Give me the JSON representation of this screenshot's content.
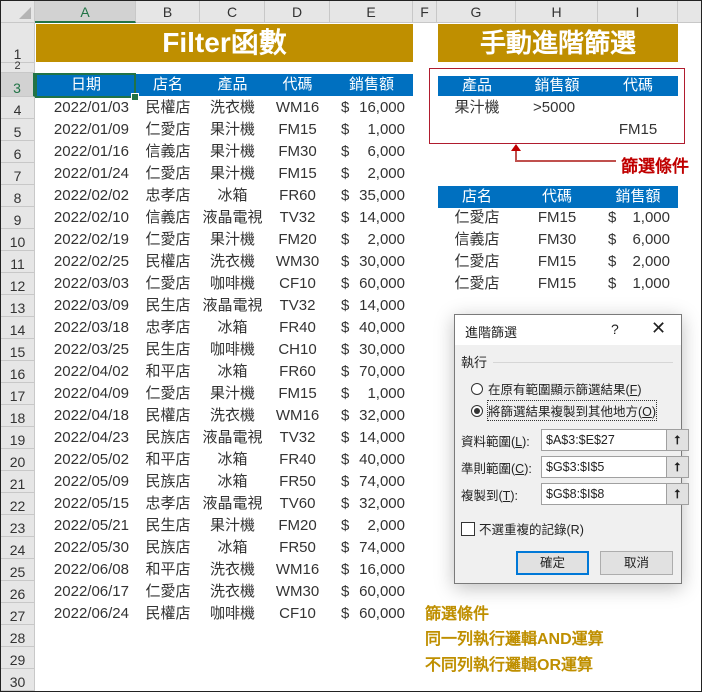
{
  "columns": [
    "A",
    "B",
    "C",
    "D",
    "E",
    "F",
    "G",
    "H",
    "I"
  ],
  "rows": [
    "1",
    "2",
    "3",
    "4",
    "5",
    "6",
    "7",
    "8",
    "9",
    "10",
    "11",
    "12",
    "13",
    "14",
    "15",
    "16",
    "17",
    "18",
    "19",
    "20",
    "21",
    "22",
    "23",
    "24",
    "25",
    "26",
    "27",
    "28",
    "29",
    "30"
  ],
  "left_title": "Filter函數",
  "right_title": "手動進階篩選",
  "main_table": {
    "headers": [
      "日期",
      "店名",
      "產品",
      "代碼",
      "銷售額"
    ],
    "currency_symbol": "$",
    "rows": [
      [
        "2022/01/03",
        "民權店",
        "洗衣機",
        "WM16",
        "16,000"
      ],
      [
        "2022/01/09",
        "仁愛店",
        "果汁機",
        "FM15",
        "1,000"
      ],
      [
        "2022/01/16",
        "信義店",
        "果汁機",
        "FM30",
        "6,000"
      ],
      [
        "2022/01/24",
        "仁愛店",
        "果汁機",
        "FM15",
        "2,000"
      ],
      [
        "2022/02/02",
        "忠孝店",
        "冰箱",
        "FR60",
        "35,000"
      ],
      [
        "2022/02/10",
        "信義店",
        "液晶電視",
        "TV32",
        "14,000"
      ],
      [
        "2022/02/19",
        "仁愛店",
        "果汁機",
        "FM20",
        "2,000"
      ],
      [
        "2022/02/25",
        "民權店",
        "洗衣機",
        "WM30",
        "30,000"
      ],
      [
        "2022/03/03",
        "仁愛店",
        "咖啡機",
        "CF10",
        "60,000"
      ],
      [
        "2022/03/09",
        "民生店",
        "液晶電視",
        "TV32",
        "14,000"
      ],
      [
        "2022/03/18",
        "忠孝店",
        "冰箱",
        "FR40",
        "40,000"
      ],
      [
        "2022/03/25",
        "民生店",
        "咖啡機",
        "CH10",
        "30,000"
      ],
      [
        "2022/04/02",
        "和平店",
        "冰箱",
        "FR60",
        "70,000"
      ],
      [
        "2022/04/09",
        "仁愛店",
        "果汁機",
        "FM15",
        "1,000"
      ],
      [
        "2022/04/18",
        "民權店",
        "洗衣機",
        "WM16",
        "32,000"
      ],
      [
        "2022/04/23",
        "民族店",
        "液晶電視",
        "TV32",
        "14,000"
      ],
      [
        "2022/05/02",
        "和平店",
        "冰箱",
        "FR40",
        "40,000"
      ],
      [
        "2022/05/09",
        "民族店",
        "冰箱",
        "FR50",
        "74,000"
      ],
      [
        "2022/05/15",
        "忠孝店",
        "液晶電視",
        "TV60",
        "32,000"
      ],
      [
        "2022/05/21",
        "民生店",
        "果汁機",
        "FM20",
        "2,000"
      ],
      [
        "2022/05/30",
        "民族店",
        "冰箱",
        "FR50",
        "74,000"
      ],
      [
        "2022/06/08",
        "和平店",
        "洗衣機",
        "WM16",
        "16,000"
      ],
      [
        "2022/06/17",
        "仁愛店",
        "洗衣機",
        "WM30",
        "60,000"
      ],
      [
        "2022/06/24",
        "民權店",
        "咖啡機",
        "CF10",
        "60,000"
      ]
    ]
  },
  "criteria": {
    "headers": [
      "產品",
      "銷售額",
      "代碼"
    ],
    "rows": [
      [
        "果汁機",
        ">5000",
        ""
      ],
      [
        "",
        "",
        "FM15"
      ]
    ],
    "label": "篩選條件"
  },
  "result_table": {
    "headers": [
      "店名",
      "代碼",
      "銷售額"
    ],
    "currency_symbol": "$",
    "rows": [
      [
        "仁愛店",
        "FM15",
        "1,000"
      ],
      [
        "信義店",
        "FM30",
        "6,000"
      ],
      [
        "仁愛店",
        "FM15",
        "2,000"
      ],
      [
        "仁愛店",
        "FM15",
        "1,000"
      ]
    ]
  },
  "dialog": {
    "title": "進階篩選",
    "help": "?",
    "close": "✕",
    "group_label": "執行",
    "option1": {
      "text": "在原有範圍顯示篩選結果(",
      "key": "F",
      "end": ")",
      "selected": false
    },
    "option2": {
      "text": "將篩選結果複製到其他地方(",
      "key": "O",
      "end": ")",
      "selected": true
    },
    "list_range": {
      "label": "資料範圍(",
      "key": "L",
      "end": "):",
      "value": "$A$3:$E$27"
    },
    "criteria_range": {
      "label": "準則範圍(",
      "key": "C",
      "end": "):",
      "value": "$G$3:$I$5"
    },
    "copy_to": {
      "label": "複製到(",
      "key": "T",
      "end": "):",
      "value": "$G$8:$I$8"
    },
    "collapse_icon": "⭡",
    "unique_only": {
      "text": "不選重複的記錄(R)",
      "checked": false
    },
    "ok": "確定",
    "cancel": "取消"
  },
  "notes": [
    "篩選條件",
    "同一列執行邏輯AND運算",
    "不同列執行邏輯OR運算"
  ],
  "colors": {
    "banner": "#bf8f00",
    "header_blue": "#0070c0",
    "criteria_red": "#c00000",
    "note_gold": "#bf8f00"
  }
}
